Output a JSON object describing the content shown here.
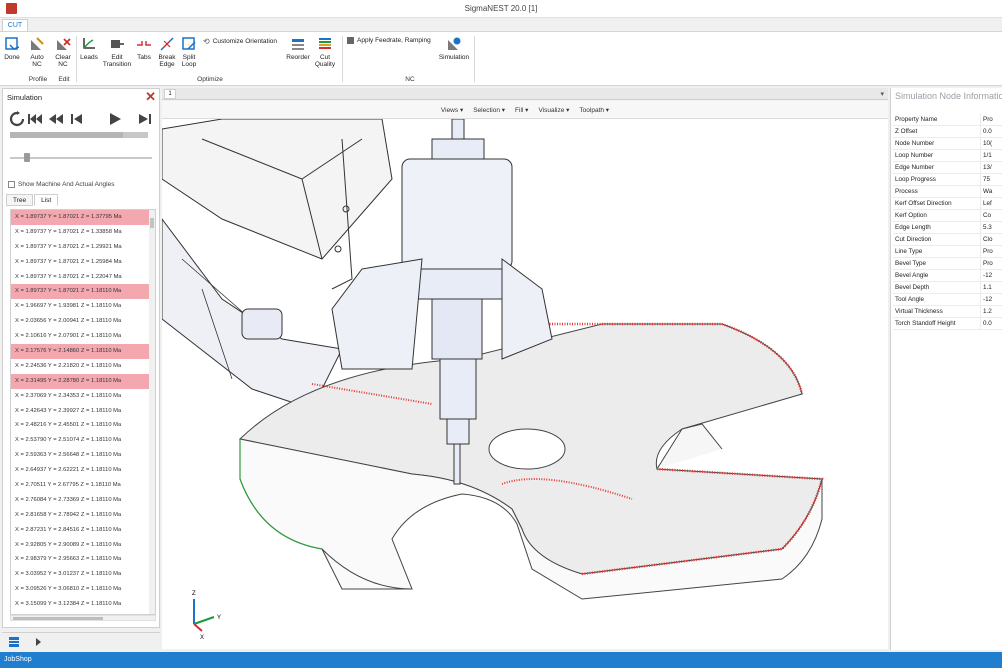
{
  "window": {
    "title": "SigmaNEST 20.0 [1]"
  },
  "ribbon": {
    "tab": "CUT",
    "buttons": {
      "done": "Done",
      "auto_nc": "Auto NC",
      "clear_nc": "Clear NC",
      "leads": "Leads",
      "edit_transition": "Edit Transition",
      "tabs": "Tabs",
      "break_edge": "Break Edge",
      "split_loop": "Split Loop",
      "customize_orientation": "Customize Orientation",
      "reorder": "Reorder",
      "cut_quality": "Cut Quality",
      "apply_feedrate": "Apply Feedrate, Ramping",
      "simulation": "Simulation"
    },
    "groups": {
      "profile": "Profile",
      "edit": "Edit",
      "optimize": "Optimize",
      "nc": "NC"
    }
  },
  "simulation": {
    "title": "Simulation",
    "checkbox_label": "Show Machine And Actual Angles",
    "tabs": [
      "Tree",
      "List"
    ],
    "active_tab": "List",
    "progress": 0.82,
    "slider": 0.1,
    "rows": [
      {
        "text": "X = 1.89737  Y = 1.87021  Z = 1.37795 Ma",
        "hl": true
      },
      {
        "text": "X = 1.89737  Y = 1.87021  Z = 1.33858 Ma",
        "hl": false
      },
      {
        "text": "X = 1.89737  Y = 1.87021  Z = 1.29921 Ma",
        "hl": false
      },
      {
        "text": "X = 1.89737  Y = 1.87021  Z = 1.25984 Ma",
        "hl": false
      },
      {
        "text": "X = 1.89737  Y = 1.87021  Z = 1.22047 Ma",
        "hl": false
      },
      {
        "text": "X = 1.89737  Y = 1.87021  Z = 1.18110 Ma",
        "hl": true
      },
      {
        "text": "X = 1.96697  Y = 1.93981  Z = 1.18110 Ma",
        "hl": false
      },
      {
        "text": "X = 2.03656  Y = 2.00941  Z = 1.18110 Ma",
        "hl": false
      },
      {
        "text": "X = 2.10616  Y = 2.07901  Z = 1.18110 Ma",
        "hl": false
      },
      {
        "text": "X = 2.17576  Y = 2.14860  Z = 1.18110 Ma",
        "hl": true
      },
      {
        "text": "X = 2.24536  Y = 2.21820  Z = 1.18110 Ma",
        "hl": false
      },
      {
        "text": "X = 2.31495  Y = 2.28780  Z = 1.18110 Ma",
        "hl": true
      },
      {
        "text": "X = 2.37069  Y = 2.34353  Z = 1.18110 Ma",
        "hl": false
      },
      {
        "text": "X = 2.42643  Y = 2.39927  Z = 1.18110 Ma",
        "hl": false
      },
      {
        "text": "X = 2.48216  Y = 2.45501  Z = 1.18110 Ma",
        "hl": false
      },
      {
        "text": "X = 2.53790  Y = 2.51074  Z = 1.18110 Ma",
        "hl": false
      },
      {
        "text": "X = 2.59363  Y = 2.56648  Z = 1.18110 Ma",
        "hl": false
      },
      {
        "text": "X = 2.64937  Y = 2.62221  Z = 1.18110 Ma",
        "hl": false
      },
      {
        "text": "X = 2.70511  Y = 2.67795  Z = 1.18110 Ma",
        "hl": false
      },
      {
        "text": "X = 2.76084  Y = 2.73369  Z = 1.18110 Ma",
        "hl": false
      },
      {
        "text": "X = 2.81658  Y = 2.78942  Z = 1.18110 Ma",
        "hl": false
      },
      {
        "text": "X = 2.87231  Y = 2.84516  Z = 1.18110 Ma",
        "hl": false
      },
      {
        "text": "X = 2.92805  Y = 2.90089  Z = 1.18110 Ma",
        "hl": false
      },
      {
        "text": "X = 2.98379  Y = 2.95663  Z = 1.18110 Ma",
        "hl": false
      },
      {
        "text": "X = 3.03952  Y = 3.01237  Z = 1.18110 Ma",
        "hl": false
      },
      {
        "text": "X = 3.09526  Y = 3.06810  Z = 1.18110 Ma",
        "hl": false
      },
      {
        "text": "X = 3.15099  Y = 3.12384  Z = 1.18110 Ma",
        "hl": false
      }
    ]
  },
  "viewport": {
    "tab": "1",
    "toolbar": [
      "Views",
      "Selection",
      "Fill",
      "Visualize",
      "Toolpath"
    ],
    "axes": {
      "z": "Z",
      "y": "Y",
      "x": "X"
    }
  },
  "properties": {
    "title": "Simulation Node Information",
    "header": {
      "k": "Property Name",
      "v": "Pro"
    },
    "rows": [
      {
        "k": "Z Offset",
        "v": "0.0"
      },
      {
        "k": "Node Number",
        "v": "10("
      },
      {
        "k": "Loop Number",
        "v": "1/1"
      },
      {
        "k": "Edge Number",
        "v": "13/"
      },
      {
        "k": "Loop Progress",
        "v": "75"
      },
      {
        "k": "Process",
        "v": "Wa"
      },
      {
        "k": "Kerf Offset Direction",
        "v": "Lef"
      },
      {
        "k": "Kerf Option",
        "v": "Co"
      },
      {
        "k": "Edge Length",
        "v": "5.3"
      },
      {
        "k": "Cut Direction",
        "v": "Clo"
      },
      {
        "k": "Line Type",
        "v": "Pro"
      },
      {
        "k": "Bevel Type",
        "v": "Pro"
      },
      {
        "k": "Bevel Angle",
        "v": "-12"
      },
      {
        "k": "Bevel Depth",
        "v": "1.1"
      },
      {
        "k": "Tool Angle",
        "v": "-12"
      },
      {
        "k": "Virtual Thickness",
        "v": "1.2"
      },
      {
        "k": "Torch Standoff Height",
        "v": "0.0"
      }
    ]
  },
  "status": {
    "text": "JobShop"
  },
  "colors": {
    "accent": "#1f7fce",
    "highlight_row": "#f3a8b0",
    "toolpath": "#e53935",
    "close": "#c0392b"
  }
}
